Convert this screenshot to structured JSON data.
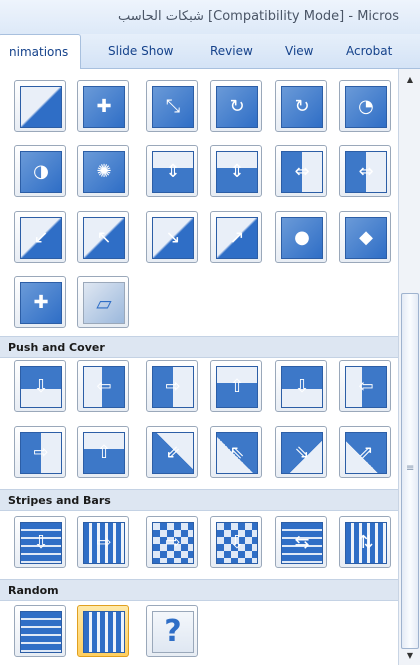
{
  "window": {
    "title": "شبكات الحاسب [Compatibility Mode] - Micros"
  },
  "tabs": [
    {
      "label": "nimations"
    },
    {
      "label": "Slide Show"
    },
    {
      "label": "Review"
    },
    {
      "label": "View"
    },
    {
      "label": "Acrobat"
    }
  ],
  "sections": [
    {
      "label": "Push and Cover"
    },
    {
      "label": "Stripes and Bars"
    },
    {
      "label": "Random"
    }
  ],
  "scrollbar": {
    "up_arrow": "▲",
    "down_arrow": "▼",
    "grip": "≡"
  },
  "random_tile_symbol": "?",
  "colors": {
    "accent": "#2f6ec6",
    "section_bg": "#dde6f2",
    "selected": "#ffcf60"
  }
}
